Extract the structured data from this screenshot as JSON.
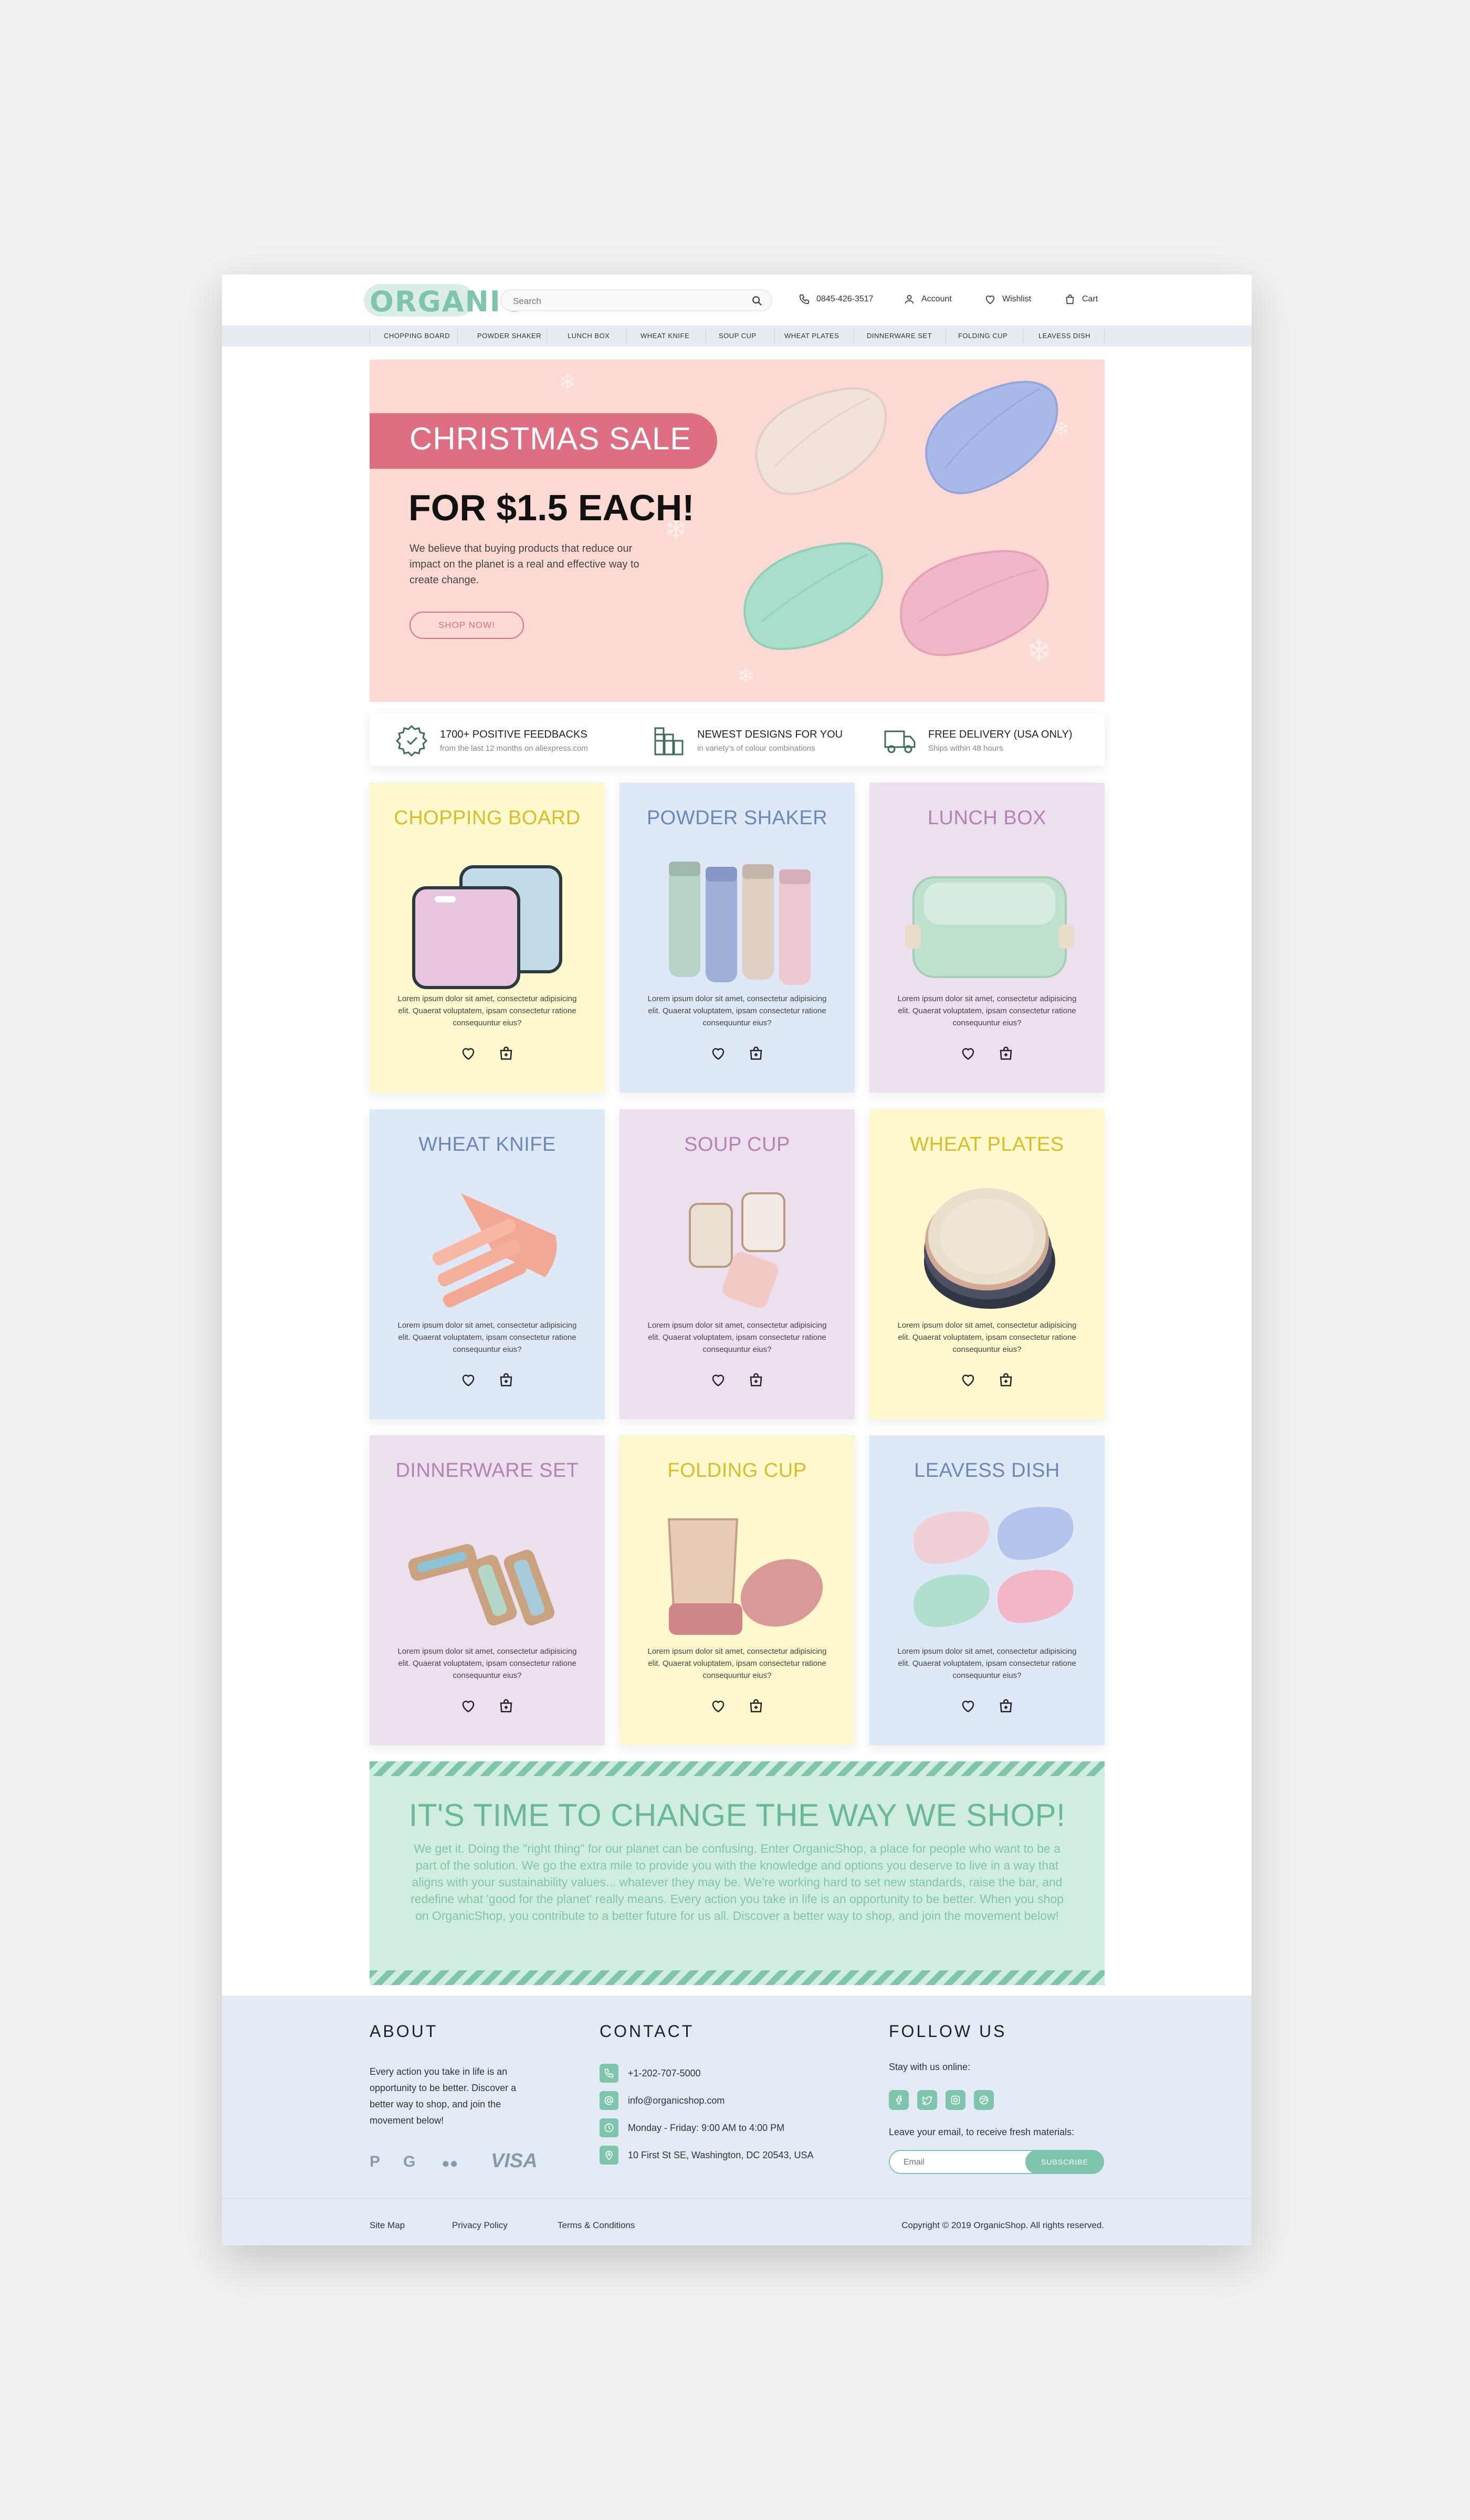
{
  "header": {
    "logo": "ORGANIC",
    "search_placeholder": "Search",
    "phone": "0845-426-3517",
    "account": "Account",
    "wishlist": "Wishlist",
    "cart": "Cart"
  },
  "categories": [
    "CHOPPING BOARD",
    "POWDER SHAKER",
    "LUNCH BOX",
    "WHEAT KNIFE",
    "SOUP CUP",
    "WHEAT PLATES",
    "DINNERWARE SET",
    "FOLDING CUP",
    "LEAVESS DISH"
  ],
  "hero": {
    "sale": "CHRISTMAS SALE",
    "price": "FOR $1.5 EACH!",
    "text": "We believe that buying products that reduce our impact on the planet is a real and effective way to create change.",
    "button": "SHOP NOW!"
  },
  "features": [
    {
      "title": "1700+ POSITIVE FEEDBACKS",
      "sub": "from the last 12 months on aliexpress.com",
      "icon": "badge-icon"
    },
    {
      "title": "NEWEST DESIGNS FOR YOU",
      "sub": "in variety's of colour combinations",
      "icon": "palette-icon"
    },
    {
      "title": "FREE DELIVERY (USA ONLY)",
      "sub": "Ships within 48 hours",
      "icon": "truck-icon"
    }
  ],
  "products": [
    {
      "title": "CHOPPING BOARD",
      "desc": "Lorem ipsum dolor sit amet, consectetur adipisicing elit. Quaerat voluptatem, ipsam consectetur ratione consequuntur eius?"
    },
    {
      "title": "POWDER SHAKER",
      "desc": "Lorem ipsum dolor sit amet, consectetur adipisicing elit. Quaerat voluptatem, ipsam consectetur ratione consequuntur eius?"
    },
    {
      "title": "LUNCH BOX",
      "desc": "Lorem ipsum dolor sit amet, consectetur adipisicing elit. Quaerat voluptatem, ipsam consectetur ratione consequuntur eius?"
    },
    {
      "title": "WHEAT KNIFE",
      "desc": "Lorem ipsum dolor sit amet, consectetur adipisicing elit. Quaerat voluptatem, ipsam consectetur ratione consequuntur eius?"
    },
    {
      "title": "SOUP CUP",
      "desc": "Lorem ipsum dolor sit amet, consectetur adipisicing elit. Quaerat voluptatem, ipsam consectetur ratione consequuntur eius?"
    },
    {
      "title": "WHEAT PLATES",
      "desc": "Lorem ipsum dolor sit amet, consectetur adipisicing elit. Quaerat voluptatem, ipsam consectetur ratione consequuntur eius?"
    },
    {
      "title": "DINNERWARE SET",
      "desc": "Lorem ipsum dolor sit amet, consectetur adipisicing elit. Quaerat voluptatem, ipsam consectetur ratione consequuntur eius?"
    },
    {
      "title": "FOLDING CUP",
      "desc": "Lorem ipsum dolor sit amet, consectetur adipisicing elit. Quaerat voluptatem, ipsam consectetur ratione consequuntur eius?"
    },
    {
      "title": "LEAVESS DISH",
      "desc": "Lorem ipsum dolor sit amet, consectetur adipisicing elit. Quaerat voluptatem, ipsam consectetur ratione consequuntur eius?"
    }
  ],
  "banner": {
    "title": "IT'S TIME TO CHANGE THE WAY WE SHOP!",
    "text": "We get it. Doing the \"right thing\" for our planet can be confusing. Enter OrganicShop, a place for people who want to be a part of the solution. We go the extra mile to provide you with the knowledge and options you deserve to live in a way that aligns with your sustainability values... whatever they may be. We're working hard to set new standards, raise the bar, and redefine what 'good for the planet' really means. Every action you take in life is an opportunity to be better. When you shop on OrganicShop, you contribute to a better future for us all. Discover a better way to shop, and join the movement below!"
  },
  "footer": {
    "about_head": "ABOUT",
    "about_text": "Every action you take in life is an opportunity to be better. Discover a better way to shop, and join the movement below!",
    "payments": [
      "P",
      "G",
      "●●",
      "VISA"
    ],
    "contact_head": "CONTACT",
    "contacts": [
      {
        "text": "+1-202-707-5000",
        "icon": "phone-icon"
      },
      {
        "text": "info@organicshop.com",
        "icon": "at-icon"
      },
      {
        "text": "Monday - Friday: 9:00 AM to 4:00 PM",
        "icon": "clock-icon"
      },
      {
        "text": "10 First St SE, Washington, DC 20543, USA",
        "icon": "location-icon"
      }
    ],
    "follow_head": "FOLLOW US",
    "stay": "Stay with us online:",
    "leave": "Leave your email, to receive fresh materials:",
    "email_placeholder": "Email",
    "subscribe": "SUBSCRIBE",
    "links": [
      "Site Map",
      "Privacy Policy",
      "Terms & Conditions"
    ],
    "copyright": "Copyright © 2019 OrganicShop. All rights reserved."
  },
  "colors": {
    "accent": "#7fc4ad",
    "pink": "#dd6e84",
    "yellow_card": "#fdf8cd",
    "blue_card": "#dfe8f6",
    "purple_card": "#ece0ee"
  }
}
